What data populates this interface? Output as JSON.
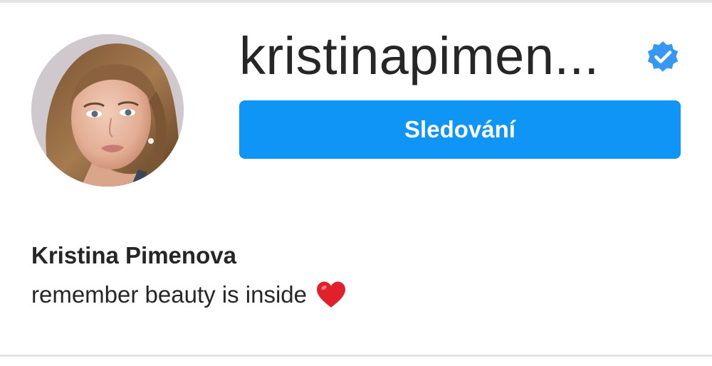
{
  "profile": {
    "username": "kristinapimen...",
    "verified_icon": "verified-badge-icon",
    "follow_button_label": "Sledování",
    "full_name": "Kristina Pimenova",
    "bio": "remember beauty is inside",
    "bio_emoji": "heart-icon"
  },
  "colors": {
    "accent": "#0e95f6",
    "verified": "#3897f0",
    "heart": "#e0202b",
    "text": "#262626"
  }
}
